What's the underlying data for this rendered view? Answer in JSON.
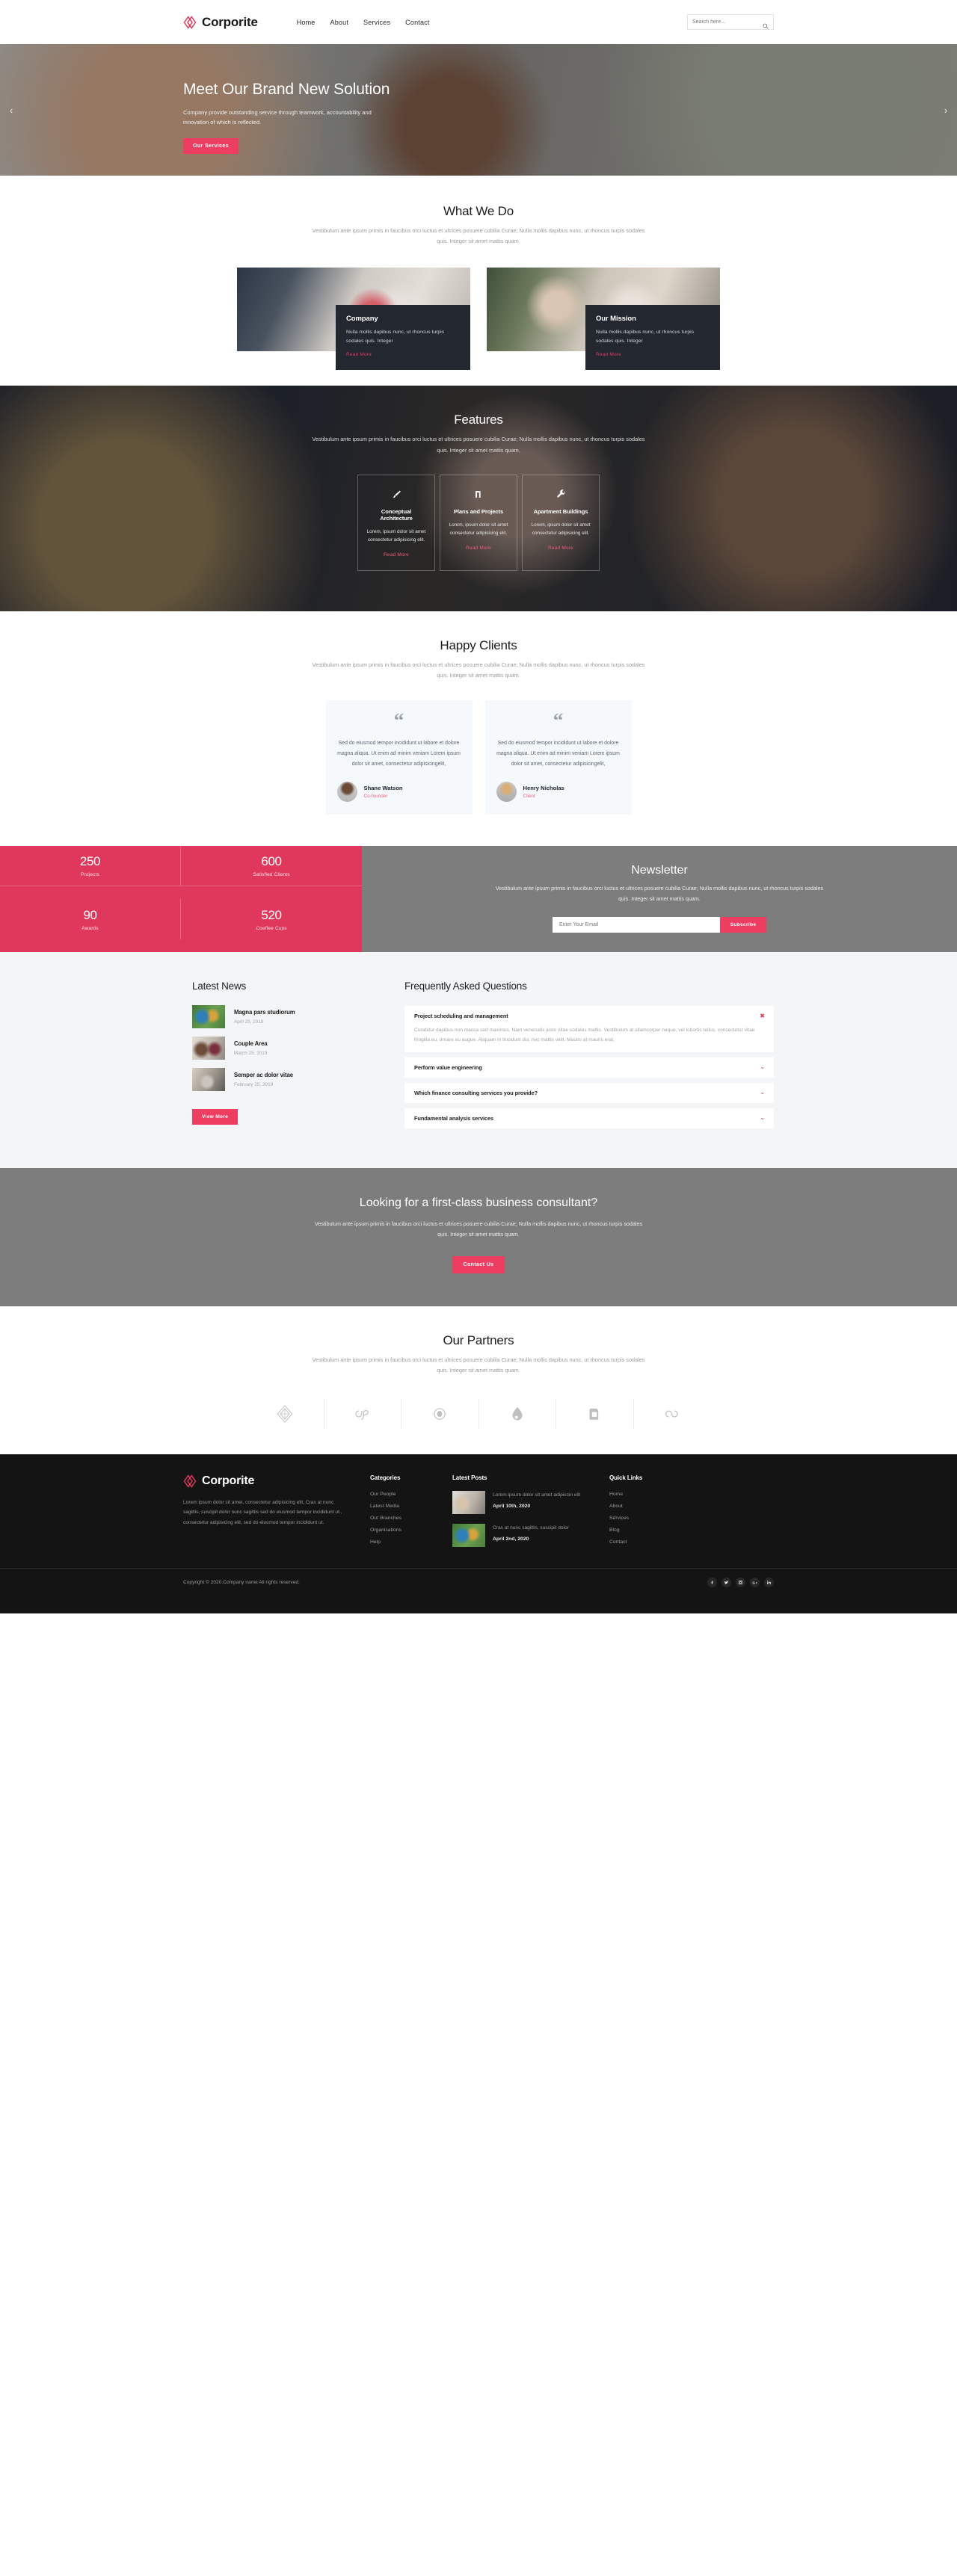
{
  "header": {
    "brand": "Corporite",
    "brand_icon": "diamond-logo-icon",
    "nav": [
      {
        "label": "Home",
        "active": true
      },
      {
        "label": "About",
        "active": false
      },
      {
        "label": "Services",
        "active": false
      },
      {
        "label": "Contact",
        "active": false
      }
    ],
    "search": {
      "placeholder": "Search here...",
      "value": "",
      "icon": "search-icon"
    }
  },
  "hero": {
    "title": "Meet Our Brand New Solution",
    "subtitle": "Company provide outstanding service through teamwork, accountability and innovation of which is reflected.",
    "cta": "Our Services",
    "prev_icon": "chevron-left-icon",
    "next_icon": "chevron-right-icon"
  },
  "what_we_do": {
    "title": "What We Do",
    "subtitle": "Vestibulum ante ipsum primis in faucibus orci luctus et ultrices posuere cubilia Curae; Nulla mollis dapibus nunc, ut rhoncus turpis sodales quis. Integer sit amet mattis quam.",
    "cards": [
      {
        "title": "Company",
        "text": "Nulla mollis dapibus nunc, ut rhoncus turpis sodales quis. Integer",
        "link": "Read More"
      },
      {
        "title": "Our Mission",
        "text": "Nulla mollis dapibus nunc, ut rhoncus turpis sodales quis. Integer",
        "link": "Read More"
      }
    ]
  },
  "features": {
    "title": "Features",
    "subtitle": "Vestibulum ante ipsum primis in faucibus orci luctus et ultrices posuere cubilia Curae; Nulla mollis dapibus nunc, ut rhoncus turpis sodales quis. Integer sit amet mattis quam.",
    "cards": [
      {
        "icon": "paint-brush-icon",
        "title": "Conceptual Architecture",
        "text": "Lorem, ipsum dolor sit amet consectetur adipisicing elit.",
        "link": "Read More"
      },
      {
        "icon": "shekel-sign-icon",
        "title": "Plans and Projects",
        "text": "Lorem, ipsum dolor sit amet consectetur adipisicing elit.",
        "link": "Read More"
      },
      {
        "icon": "wrench-icon",
        "title": "Apartment Buildings",
        "text": "Lorem, ipsum dolor sit amet consectetur adipisicing elit.",
        "link": "Read More"
      }
    ]
  },
  "clients": {
    "title": "Happy Clients",
    "subtitle": "Vestibulum ante ipsum primis in faucibus orci luctus et ultrices posuere cubilia Curae; Nulla mollis dapibus nunc, ut rhoncus turpis sodales quis. Integer sit amet mattis quam.",
    "quote_glyph": "“",
    "testimonials": [
      {
        "text": "Sed do eiusmod tempor incididunt ut labore et dolore magna aliqua. Ut enim ad minim veniam Lorem ipsum dolor sit amet, consectetur adipisicingelit,",
        "name": "Shane Watson",
        "role": "Co-founder"
      },
      {
        "text": "Sed do eiusmod tempor incididunt ut labore et dolore magna aliqua. Ut enim ad minim veniam Lorem ipsum dolor sit amet, consectetur adipisicingelit,",
        "name": "Henry Nicholas",
        "role": "Client"
      }
    ]
  },
  "stats": [
    {
      "value": "250",
      "label": "Projects"
    },
    {
      "value": "600",
      "label": "Satisfied Clients"
    },
    {
      "value": "90",
      "label": "Awards"
    },
    {
      "value": "520",
      "label": "Coeffee Cups"
    }
  ],
  "newsletter": {
    "title": "Newsletter",
    "subtitle": "Vestibulum ante ipsum primis in faucibus orci luctus et ultrices posuere cubilia Curae; Nulla mollis dapibus nunc, ut rhoncus turpis sodales quis. Integer sit amet mattis quam.",
    "placeholder": "Enter Your Email",
    "value": "",
    "button": "Subscribe"
  },
  "latest_news": {
    "title": "Latest News",
    "items": [
      {
        "title": "Magna pars studiorum",
        "date": "April 25, 2019"
      },
      {
        "title": "Couple Area",
        "date": "March 25, 2019"
      },
      {
        "title": "Semper ac dolor vitae",
        "date": "February 25, 2019"
      }
    ],
    "button": "View More"
  },
  "faq": {
    "title": "Frequently Asked Questions",
    "items": [
      {
        "q": "Project scheduling and management",
        "open": true,
        "sign": "✖",
        "a": "Curabitur dapibus non massa sed maximus. Nam venenatis justo vitae sodales mattis. Vestibulum at ullamcorper neque, vel lobortis tellus, consectetur vitae fringilla eu, ornare eu augue. Aliquam in tincidunt dui, nec mattis velit. Mauris at mauris erat."
      },
      {
        "q": "Perform value engineering",
        "open": false,
        "sign": "⌄",
        "a": ""
      },
      {
        "q": "Which finance consulting services you provide?",
        "open": false,
        "sign": "⌄",
        "a": ""
      },
      {
        "q": "Fundamental analysis services",
        "open": false,
        "sign": "⌄",
        "a": ""
      }
    ]
  },
  "cta": {
    "title": "Looking for a first-class business consultant?",
    "subtitle": "Vestibulum ante ipsum primis in faucibus orci luctus et ultrices posuere cubilia Curae; Nulla mollis dapibus nunc, ut rhoncus turpis sodales quis. Integer sit amet mattis quam.",
    "button": "Contact Us"
  },
  "partners": {
    "title": "Our Partners",
    "subtitle": "Vestibulum ante ipsum primis in faucibus orci luctus et ultrices posuere cubilia Curae; Nulla mollis dapibus nunc, ut rhoncus turpis sodales quis. Integer sit amet mattis quam.",
    "logos": [
      "diamond-partner-icon",
      "lastfm-partner-icon",
      "cc-partner-icon",
      "drupal-partner-icon",
      "nokia-partner-icon",
      "infinity-partner-icon"
    ]
  },
  "footer": {
    "brand": "Corporite",
    "about": "Lorem ipsum dolor sit amet, consectetur adipisicing elit, Cras at nunc sagittis, suscipit dolor nunc sagittis sed do eiusmod tempor incididunt ut., consectetur adipisicing elit, sed do eiusmod tempor incididunt ut.",
    "categories": {
      "title": "Categories",
      "links": [
        "Our People",
        "Latest Media",
        "Our Branches",
        "Organisations",
        "Help"
      ]
    },
    "latest_posts": {
      "title": "Latest Posts",
      "items": [
        {
          "text": "Lorem ipsum dolor sit amet adipiscin elit",
          "date": "April 10th, 2020"
        },
        {
          "text": "Cras at nunc sagittis, suscipit dolor",
          "date": "April 2nd, 2020"
        }
      ]
    },
    "quick_links": {
      "title": "Quick Links",
      "links": [
        "Home",
        "About",
        "Services",
        "Blog",
        "Contact"
      ]
    },
    "copyright": "Copyright © 2020.Company name All rights reserved.",
    "socials": [
      {
        "name": "facebook-icon",
        "glyph": "f"
      },
      {
        "name": "twitter-icon",
        "glyph": "ᴛ"
      },
      {
        "name": "instagram-icon",
        "glyph": "▢"
      },
      {
        "name": "google-plus-icon",
        "glyph": "G+"
      },
      {
        "name": "linkedin-icon",
        "glyph": "in"
      }
    ]
  },
  "colors": {
    "accent": "#ed3e62",
    "accent_dark": "#e0385d",
    "dark": "#141414",
    "gray": "#7d7d7d"
  }
}
